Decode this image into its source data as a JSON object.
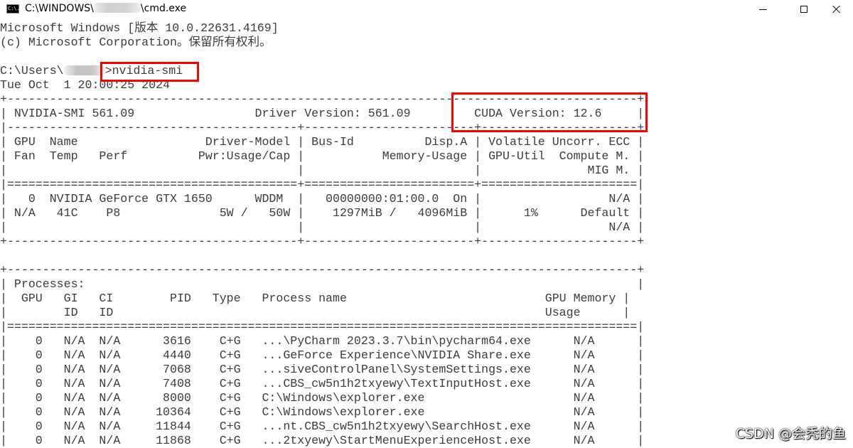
{
  "window": {
    "title_prefix": "C:\\WINDOWS\\",
    "title_suffix": "\\cmd.exe",
    "app_icon_text": "C:\\."
  },
  "console": {
    "lines": [
      "Microsoft Windows [版本 10.0.22631.4169]",
      "(c) Microsoft Corporation。保留所有权利。",
      "",
      "C:\\Users\\",
      "Tue Oct  1 20:00:25 2024",
      "+-----------------------------------------------------------------------------------------+",
      "| NVIDIA-SMI 561.09                 Driver Version: 561.09         CUDA Version: 12.6     |",
      "|-----------------------------------------+------------------------+----------------------+",
      "| GPU  Name                  Driver-Model | Bus-Id          Disp.A | Volatile Uncorr. ECC |",
      "| Fan  Temp   Perf          Pwr:Usage/Cap |           Memory-Usage | GPU-Util  Compute M. |",
      "|                                         |                        |               MIG M. |",
      "|=========================================+========================+======================|",
      "|   0  NVIDIA GeForce GTX 1650      WDDM  |   00000000:01:00.0  On |                  N/A |",
      "| N/A   41C    P8              5W /   50W |    1297MiB /   4096MiB |      1%      Default |",
      "|                                         |                        |                  N/A |",
      "+-----------------------------------------+------------------------+----------------------+",
      "",
      "+-----------------------------------------------------------------------------------------+",
      "| Processes:                                                                              |",
      "|  GPU   GI   CI        PID   Type   Process name                            GPU Memory |",
      "|        ID   ID                                                             Usage      |",
      "|=========================================================================================|",
      "|    0   N/A  N/A      3616    C+G   ...\\PyCharm 2023.3.7\\bin\\pycharm64.exe      N/A      |",
      "|    0   N/A  N/A      4440    C+G   ...GeForce Experience\\NVIDIA Share.exe      N/A      |",
      "|    0   N/A  N/A      7068    C+G   ...siveControlPanel\\SystemSettings.exe      N/A      |",
      "|    0   N/A  N/A      7408    C+G   ...CBS_cw5n1h2txyewy\\TextInputHost.exe      N/A      |",
      "|    0   N/A  N/A      8000    C+G   C:\\Windows\\explorer.exe                     N/A      |",
      "|    0   N/A  N/A     10364    C+G   C:\\Windows\\explorer.exe                     N/A      |",
      "|    0   N/A  N/A     11844    C+G   ...nt.CBS_cw5n1h2txyewy\\SearchHost.exe      N/A      |",
      "|    0   N/A  N/A     11868    C+G   ...2txyewy\\StartMenuExperienceHost.exe      N/A      |"
    ],
    "prompt_suffix": ">nvidia-smi"
  },
  "watermark": "CSDN @会秃的鱼",
  "colors": {
    "background": "#ffffff",
    "text": "#3c3c3c",
    "highlight": "#ff0000"
  },
  "icons": {
    "minimize": "minimize-icon",
    "maximize": "maximize-icon",
    "close": "close-icon",
    "app": "cmd-app-icon"
  }
}
